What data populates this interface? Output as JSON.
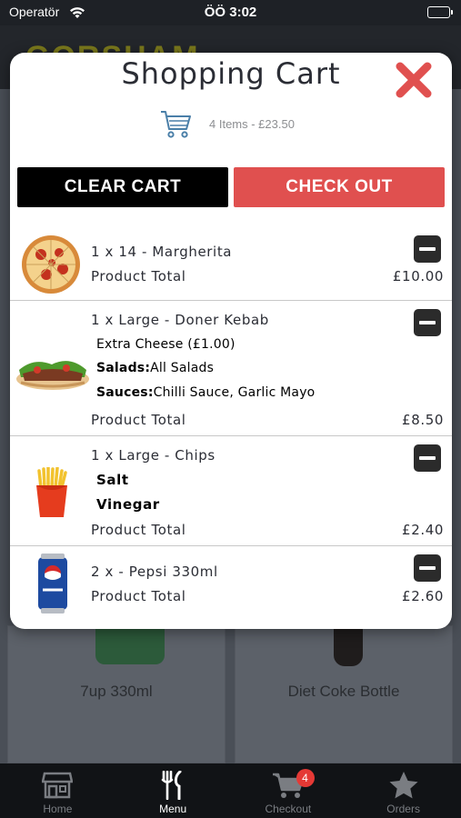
{
  "status_bar": {
    "carrier": "Operatör",
    "time": "ÖÖ 3:02"
  },
  "background": {
    "logo_text": "GORSHAM",
    "cards": [
      {
        "name": "7up 330ml"
      },
      {
        "name": "Diet Coke Bottle"
      }
    ]
  },
  "modal": {
    "title": "Shopping Cart",
    "summary": "4 Items - £23.50",
    "clear_label": "CLEAR CART",
    "checkout_label": "CHECK OUT",
    "items": [
      {
        "name": "1 x 14 - Margherita",
        "options": [],
        "total_label": "Product Total",
        "price": "£10.00",
        "image": "pizza"
      },
      {
        "name": "1 x Large - Doner Kebab",
        "options": [
          {
            "label": "",
            "value": "Extra Cheese (£1.00)"
          },
          {
            "label": "Salads:",
            "value": "All Salads"
          },
          {
            "label": "Sauces:",
            "value": "Chilli Sauce, Garlic Mayo"
          }
        ],
        "total_label": "Product Total",
        "price": "£8.50",
        "image": "kebab"
      },
      {
        "name": "1 x Large - Chips",
        "options": [
          {
            "label": "Salt",
            "value": ""
          },
          {
            "label": "Vinegar",
            "value": ""
          }
        ],
        "total_label": "Product Total",
        "price": "£2.40",
        "image": "chips"
      },
      {
        "name": "2 x - Pepsi 330ml",
        "options": [],
        "total_label": "Product Total",
        "price": "£2.60",
        "image": "pepsi-can"
      }
    ]
  },
  "tab_bar": {
    "tabs": [
      {
        "label": "Home",
        "icon": "store-icon",
        "active": false
      },
      {
        "label": "Menu",
        "icon": "fork-knife-icon",
        "active": true
      },
      {
        "label": "Checkout",
        "icon": "cart-icon",
        "active": false,
        "badge": "4"
      },
      {
        "label": "Orders",
        "icon": "star-icon",
        "active": false
      }
    ]
  },
  "colors": {
    "checkout_button": "#e0504f",
    "clear_button": "#000000",
    "close_icon": "#e0504f",
    "badge": "#e53935",
    "cart_icon": "#4a7fa8"
  }
}
